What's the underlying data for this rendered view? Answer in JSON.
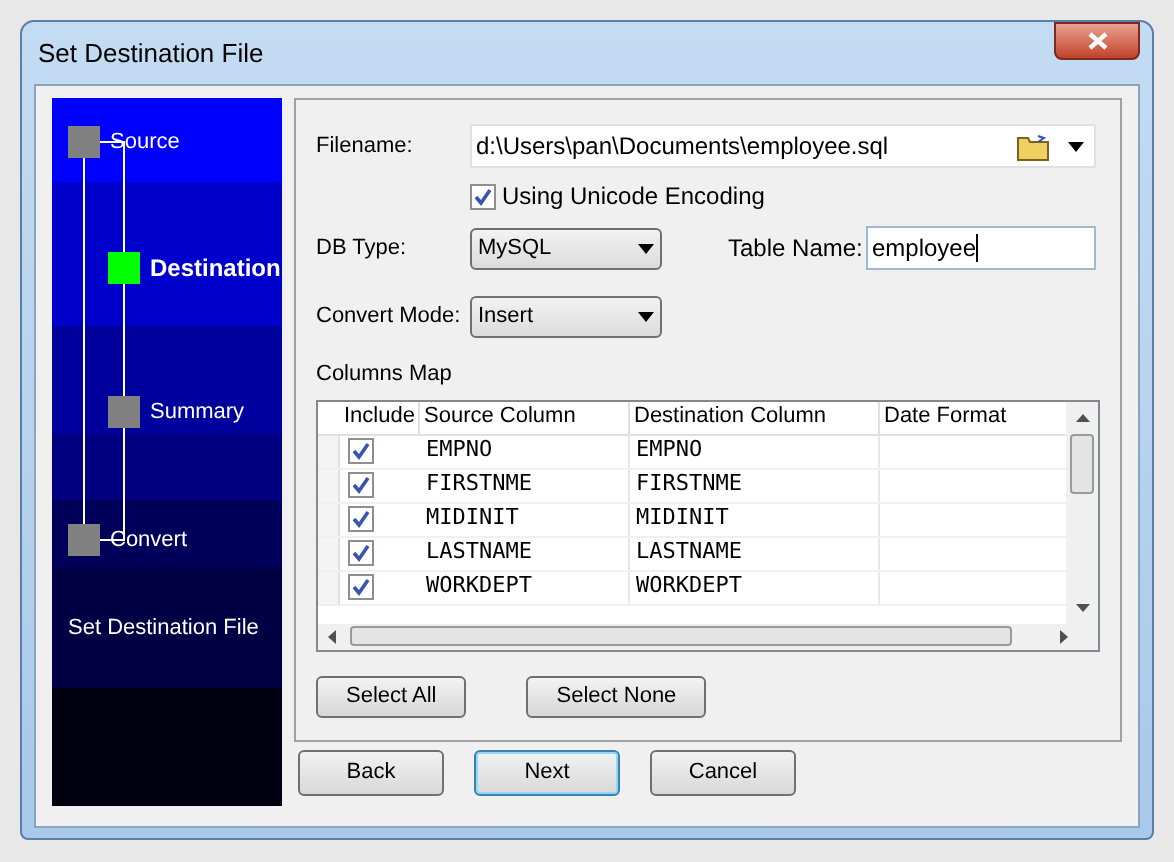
{
  "window": {
    "title": "Set Destination File"
  },
  "steps": [
    {
      "label": "Source",
      "selected": false,
      "children": [
        {
          "label": "Destination",
          "selected": true
        },
        {
          "label": "Summary",
          "selected": false
        }
      ]
    },
    {
      "label": "Convert",
      "selected": false
    }
  ],
  "sidebar_caption": "Set Destination File",
  "filename": {
    "label": "Filename:",
    "value": "d:\\Users\\pan\\Documents\\employee.sql"
  },
  "unicode": {
    "label": "Using Unicode Encoding",
    "checked": true
  },
  "db_type": {
    "label": "DB Type:",
    "value": "MySQL"
  },
  "table_name": {
    "label": "Table Name:",
    "value": "employee"
  },
  "convert_mode": {
    "label": "Convert Mode:",
    "value": "Insert"
  },
  "columns_map": {
    "title": "Columns Map",
    "columns": [
      "Include",
      "Source Column",
      "Destination Column",
      "Date Format"
    ],
    "rows": [
      {
        "include": true,
        "source": "EMPNO",
        "destination": "EMPNO"
      },
      {
        "include": true,
        "source": "FIRSTNME",
        "destination": "FIRSTNME"
      },
      {
        "include": true,
        "source": "MIDINIT",
        "destination": "MIDINIT"
      },
      {
        "include": true,
        "source": "LASTNAME",
        "destination": "LASTNAME"
      },
      {
        "include": true,
        "source": "WORKDEPT",
        "destination": "WORKDEPT"
      }
    ]
  },
  "select_buttons": [
    "Select All",
    "Select None"
  ],
  "buttons": [
    {
      "label": "Back",
      "default": false
    },
    {
      "label": "Next",
      "default": true
    },
    {
      "label": "Cancel",
      "default": false
    }
  ]
}
